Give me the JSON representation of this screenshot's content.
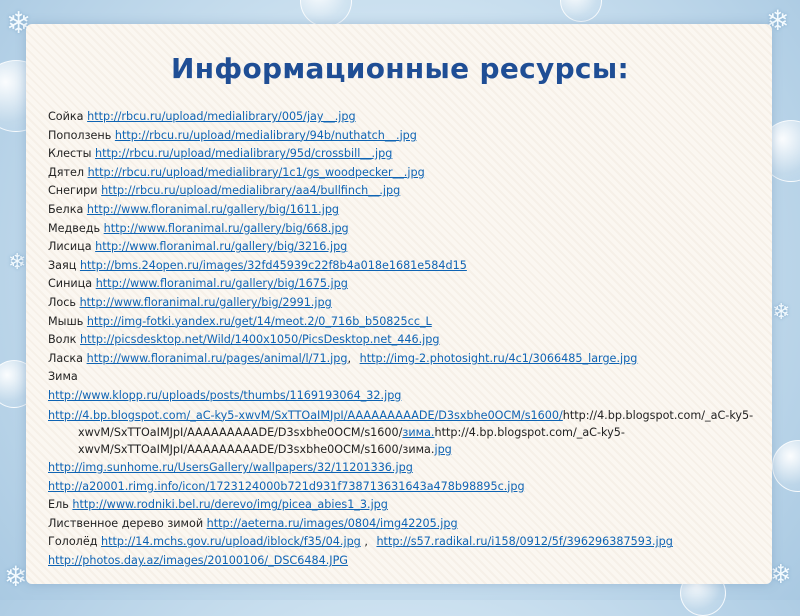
{
  "title": "Информационные ресурсы:",
  "rows": [
    {
      "label": "Сойка",
      "url": "http://rbcu.ru/upload/medialibrary/005/jay__.jpg"
    },
    {
      "label": "Поползень",
      "url": "http://rbcu.ru/upload/medialibrary/94b/nuthatch__.jpg"
    },
    {
      "label": "Клесты",
      "url": "http://rbcu.ru/upload/medialibrary/95d/crossbill__.jpg"
    },
    {
      "label": "Дятел",
      "url": "http://rbcu.ru/upload/medialibrary/1c1/gs_woodpecker__.jpg"
    },
    {
      "label": "Снегири",
      "url": "http://rbcu.ru/upload/medialibrary/aa4/bullfinch__.jpg"
    },
    {
      "label": "Белка",
      "url": "http://www.floranimal.ru/gallery/big/1611.jpg"
    },
    {
      "label": "Медведь",
      "url": "http://www.floranimal.ru/gallery/big/668.jpg"
    },
    {
      "label": "Лисица",
      "url": "http://www.floranimal.ru/gallery/big/3216.jpg"
    },
    {
      "label": "Заяц",
      "url": "http://bms.24open.ru/images/32fd45939c22f8b4a018e1681e584d15"
    },
    {
      "label": "Синица",
      "url": "http://www.floranimal.ru/gallery/big/1675.jpg"
    },
    {
      "label": "Лось",
      "url": "http://www.floranimal.ru/gallery/big/2991.jpg"
    },
    {
      "label": "Мышь",
      "url": "http://img-fotki.yandex.ru/get/14/meot.2/0_716b_b50825cc_L"
    },
    {
      "label": "Волк ",
      "url": "http://picsdesktop.net/Wild/1400x1050/PicsDesktop.net_446.jpg"
    },
    {
      "label": "Ласка",
      "url": "http://www.floranimal.ru/pages/animal/l/71.jpg",
      "sep": ",",
      "url2": "http://img-2.photosight.ru/4c1/3066485_large.jpg"
    }
  ],
  "zima_label": "Зима",
  "zima_link": "http://www.klopp.ru/uploads/posts/thumbs/1169193064_32.jpg",
  "blog": {
    "link1": "http://4.bp.blogspot.com/_aC-ky5-xwvM/SxTTOaIMJpI/AAAAAAAAADE/D3sxbhe0OCM/s1600/",
    "text1": "http://4.bp.blogspot.com/_aC-ky5-xwvM/SxTTOaIMJpI/AAAAAAAAADE/D3sxbhe0OCM/s1600/",
    "link2": "зима.",
    "text2": "http://4.bp.blogspot.com/_aC-ky5-xwvM/SxTTOaIMJpI/AAAAAAAAADE/D3sxbhe0OCM/s1600/зима.",
    "link3": "jpg"
  },
  "tail_rows": [
    {
      "label": "",
      "url": "http://img.sunhome.ru/UsersGallery/wallpapers/32/11201336.jpg"
    },
    {
      "label": "",
      "url": "http://a20001.rimg.info/icon/1723124000b721d931f738713631643a478b98895c.jpg"
    },
    {
      "label": "Ель",
      "url": "http://www.rodniki.bel.ru/derevo/img/picea_abies1_3.jpg"
    },
    {
      "label": "Лиственное дерево зимой ",
      "url": "http://aeterna.ru/images/0804/img42205.jpg"
    },
    {
      "label": "Гололёд",
      "url": "http://14.mchs.gov.ru/upload/iblock/f35/04.jpg",
      "sep": " ,",
      "url2": "http://s57.radikal.ru/i158/0912/5f/396296387593.jpg"
    },
    {
      "label": "",
      "url": "http://photos.day.az/images/20100106/_DSC6484.JPG"
    }
  ]
}
